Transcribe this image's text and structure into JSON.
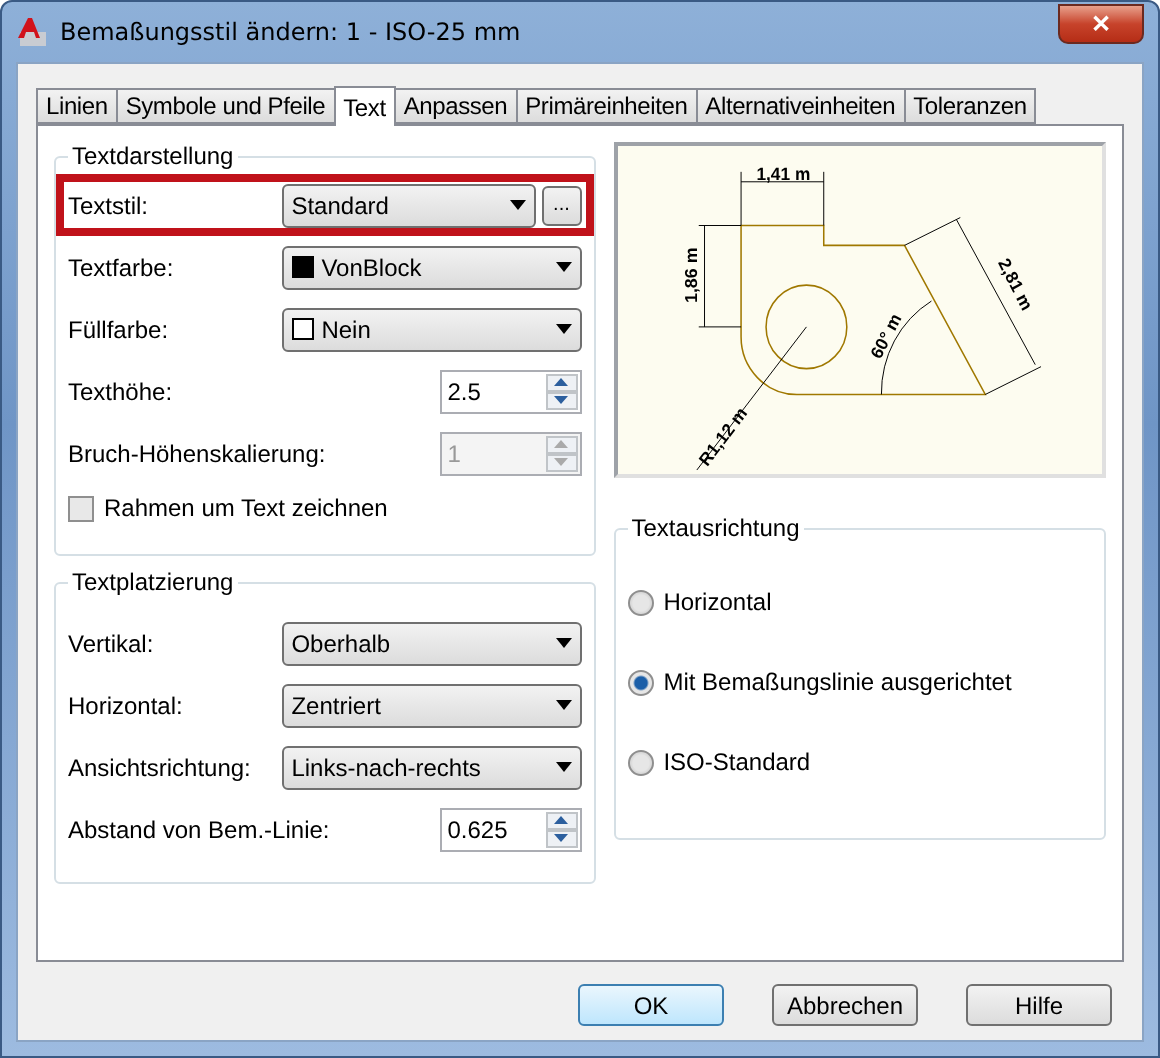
{
  "window": {
    "title": "Bemaßungsstil ändern: 1 - ISO-25 mm",
    "close": "✕"
  },
  "tabs": [
    {
      "label": "Linien",
      "selected": false
    },
    {
      "label": "Symbole und Pfeile",
      "selected": false
    },
    {
      "label": "Text",
      "selected": true
    },
    {
      "label": "Anpassen",
      "selected": false
    },
    {
      "label": "Primäreinheiten",
      "selected": false
    },
    {
      "label": "Alternativeinheiten",
      "selected": false
    },
    {
      "label": "Toleranzen",
      "selected": false
    }
  ],
  "text_appearance": {
    "title": "Textdarstellung",
    "rows": [
      {
        "kind": "select",
        "label": "Textstil:",
        "value": "Standard",
        "highlighted": true,
        "browse": "..."
      },
      {
        "kind": "select",
        "label": "Textfarbe:",
        "value": "VonBlock",
        "color": "#000000",
        "highlighted": false
      },
      {
        "kind": "select",
        "label": "Füllfarbe:",
        "value": "Nein",
        "color": "#ffffff",
        "highlighted": false
      },
      {
        "kind": "spinner",
        "label": "Texthöhe:",
        "value": "2.5",
        "disabled": false
      },
      {
        "kind": "spinner",
        "label": "Bruch-Höhenskalierung:",
        "value": "1",
        "disabled": true
      },
      {
        "kind": "checkbox",
        "label": "Rahmen um Text zeichnen",
        "checked": false
      }
    ]
  },
  "text_placement": {
    "title": "Textplatzierung",
    "rows": [
      {
        "kind": "select",
        "label": "Vertikal:",
        "value": "Oberhalb"
      },
      {
        "kind": "select",
        "label": "Horizontal:",
        "value": "Zentriert"
      },
      {
        "kind": "select",
        "label": "Ansichtsrichtung:",
        "value": "Links-nach-rechts"
      },
      {
        "kind": "spinner",
        "label": "Abstand von Bem.-Linie:",
        "value": "0.625",
        "disabled": false
      }
    ]
  },
  "preview": {
    "labels": [
      "1,41 m",
      "1,86 m",
      "2,81 m",
      "60° m",
      "R1,12 m"
    ]
  },
  "text_alignment": {
    "title": "Textausrichtung",
    "options": [
      {
        "label": "Horizontal",
        "selected": false
      },
      {
        "label": "Mit Bemaßungslinie ausgerichtet",
        "selected": true
      },
      {
        "label": "ISO-Standard",
        "selected": false
      }
    ]
  },
  "buttons": [
    "OK",
    "Abbrechen",
    "Hilfe"
  ]
}
